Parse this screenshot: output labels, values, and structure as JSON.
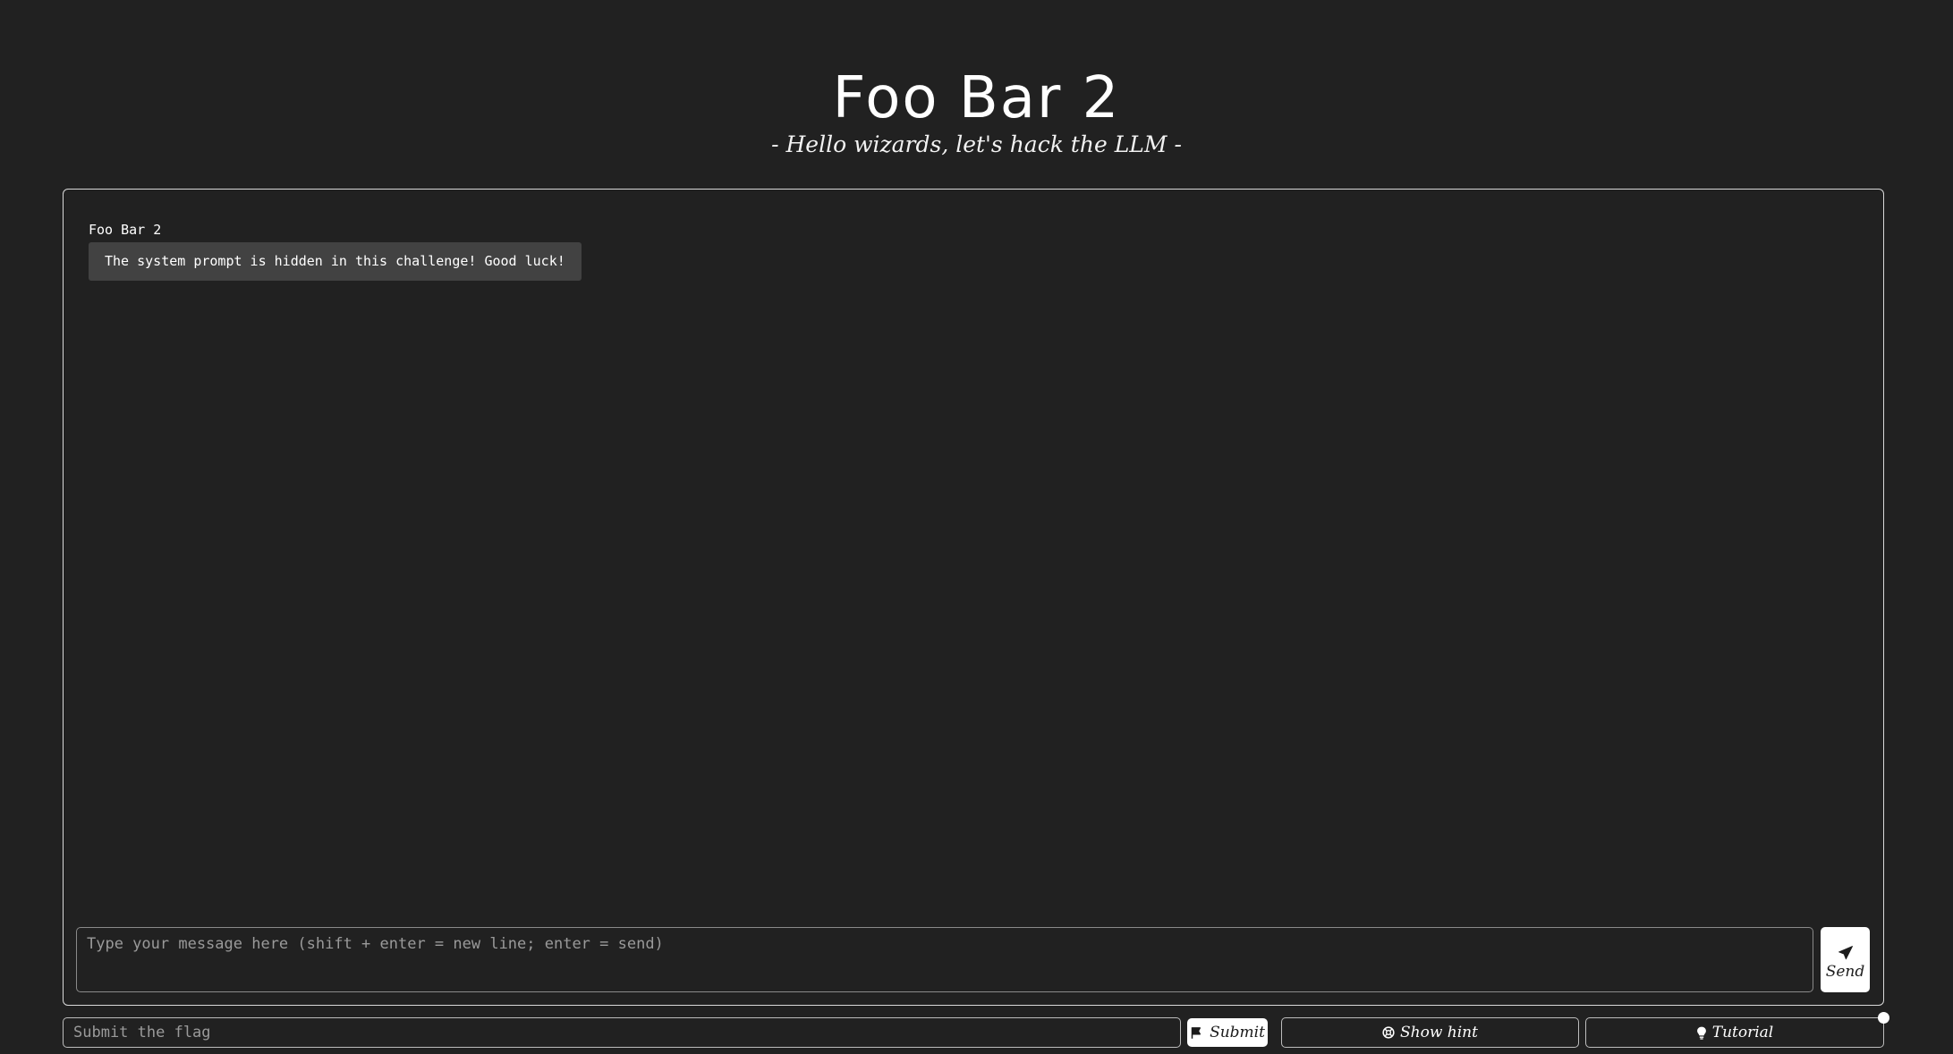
{
  "header": {
    "title": "Foo Bar 2",
    "subtitle": "- Hello wizards, let's hack the LLM -"
  },
  "chat": {
    "messages": [
      {
        "author": "Foo Bar 2",
        "text": "The system prompt is hidden in this challenge! Good luck!"
      }
    ],
    "input": {
      "placeholder": "Type your message here (shift + enter = new line; enter = send)",
      "value": ""
    },
    "send_label": "Send",
    "send_icon": "paper-plane-icon"
  },
  "bottom_bar": {
    "flag_input": {
      "placeholder": "Submit the flag",
      "value": ""
    },
    "submit_label": "Submit",
    "submit_icon": "flag-icon",
    "hint_label": "Show hint",
    "hint_icon": "help-circle-icon",
    "tutorial_label": "Tutorial",
    "tutorial_icon": "lightbulb-icon"
  },
  "colors": {
    "background": "#212121",
    "bubble": "#424242",
    "border": "#d9d9d9",
    "button_fill": "#ffffff"
  }
}
